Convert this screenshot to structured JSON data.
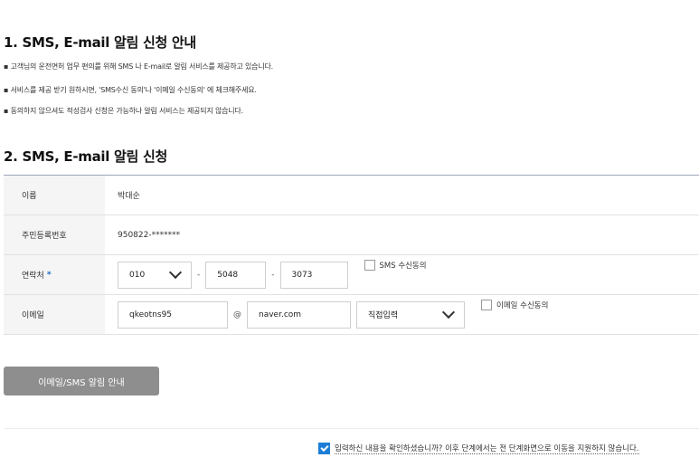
{
  "section1": {
    "title": "1. SMS, E-mail 알림 신청 안내",
    "bullets": [
      "▪ 고객님의 운전면허 업무 편의를 위해 SMS 나 E-mail로 알림 서비스를 제공하고 있습니다.",
      "▪ 서비스를 제공 받기 원하시면, 'SMS수신 동의'나 '이메일 수신동의' 에 체크해주세요.",
      "▪ 동의하지 않으셔도 적성검사 신청은 가능하나 알림 서비스는 제공되지 않습니다."
    ]
  },
  "section2": {
    "title": "2. SMS, E-mail 알림 신청",
    "name": {
      "label": "이름",
      "value": "박대순"
    },
    "ssn": {
      "label": "주민등록번호",
      "value": "950822-*******"
    },
    "phone": {
      "label": "연락처",
      "required_mark": "*",
      "prefix": "010",
      "middle": "5048",
      "last": "3073",
      "dash": "-",
      "consent_label": "SMS 수신동의",
      "consent_checked": false
    },
    "email": {
      "label": "이메일",
      "id": "qkeotns95",
      "at": "@",
      "domain": "naver.com",
      "domain_select": "직접입력",
      "consent_label": "이메일 수신동의",
      "consent_checked": false
    }
  },
  "guide_button": "이메일/SMS 알림 안내",
  "confirm": {
    "checked": true,
    "text": "입력하신 내용을 확인하셨습니까? 이후 단계에서는 전 단계화면으로 이동을 지원하지 않습니다."
  },
  "colors": {
    "accent": "#1c7ed6",
    "required": "#1c64c8",
    "button": "#8e8e8e",
    "label_bg": "#f5f5f5"
  }
}
